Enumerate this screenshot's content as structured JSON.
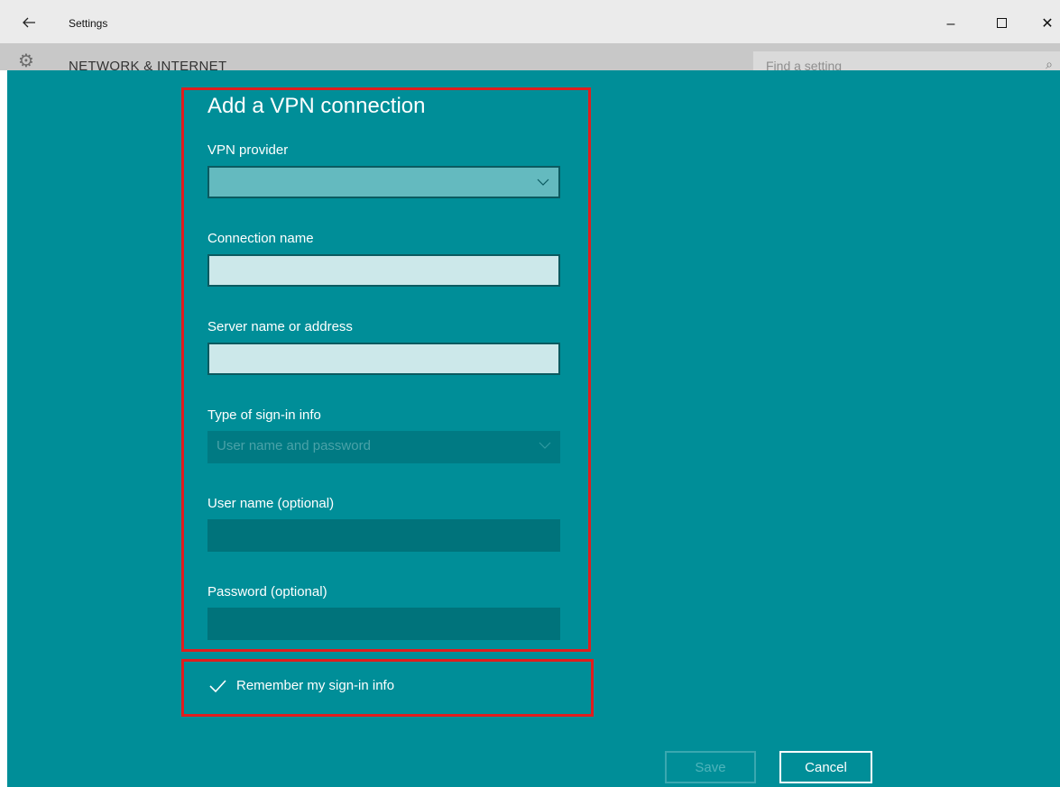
{
  "window": {
    "title": "Settings",
    "back_icon": "arrow-left-icon",
    "minimize_glyph": "–",
    "close_glyph": "✕"
  },
  "background_page": {
    "section": "NETWORK & INTERNET",
    "search_placeholder": "Find a setting"
  },
  "dialog": {
    "title": "Add a VPN connection",
    "fields": {
      "vpn_provider": {
        "label": "VPN provider",
        "value": ""
      },
      "connection_name": {
        "label": "Connection name",
        "value": ""
      },
      "server": {
        "label": "Server name or address",
        "value": ""
      },
      "signin_type": {
        "label": "Type of sign-in info",
        "value": "User name and password"
      },
      "username": {
        "label": "User name (optional)",
        "value": ""
      },
      "password": {
        "label": "Password (optional)",
        "value": ""
      }
    },
    "remember": {
      "label": "Remember my sign-in info",
      "checked": true
    },
    "buttons": {
      "save": "Save",
      "cancel": "Cancel"
    }
  },
  "colors": {
    "dialog_background": "#008e98",
    "highlight_border": "#e11d1d",
    "titlebar": "#ebebeb"
  }
}
